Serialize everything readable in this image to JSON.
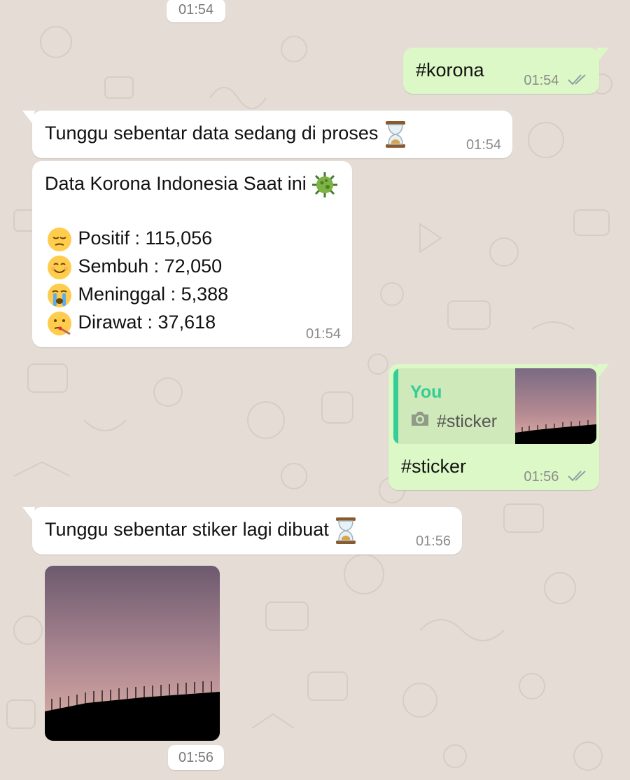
{
  "messages": {
    "top_time": "01:54",
    "korona_cmd": {
      "text": "#korona",
      "time": "01:54"
    },
    "wait_data": {
      "text": "Tunggu sebentar data sedang di proses",
      "time": "01:54"
    },
    "stats": {
      "title": "Data Korona Indonesia Saat ini",
      "positif": "Positif : 115,056",
      "sembuh": "Sembuh : 72,050",
      "meninggal": "Meninggal : 5,388",
      "dirawat": "Dirawat : 37,618",
      "time": "01:54"
    },
    "sticker_cmd": {
      "reply_name": "You",
      "reply_text": "#sticker",
      "text": "#sticker",
      "time": "01:56"
    },
    "wait_sticker": {
      "text": "Tunggu sebentar stiker lagi dibuat",
      "time": "01:56"
    },
    "sticker_time": "01:56"
  },
  "icons": {
    "hourglass": "hourglass-icon",
    "virus": "virus-icon",
    "pensive_face": "pensive-face-icon",
    "smiling_face": "smiling-face-icon",
    "crying_face": "crying-face-icon",
    "thermometer_face": "face-with-thermometer-icon",
    "read_ticks": "double-check-icon",
    "camera": "camera-icon"
  },
  "colors": {
    "background": "#e5ddd5",
    "incoming": "#ffffff",
    "outgoing": "#dcf8c6",
    "reply_accent": "#35cd96"
  }
}
